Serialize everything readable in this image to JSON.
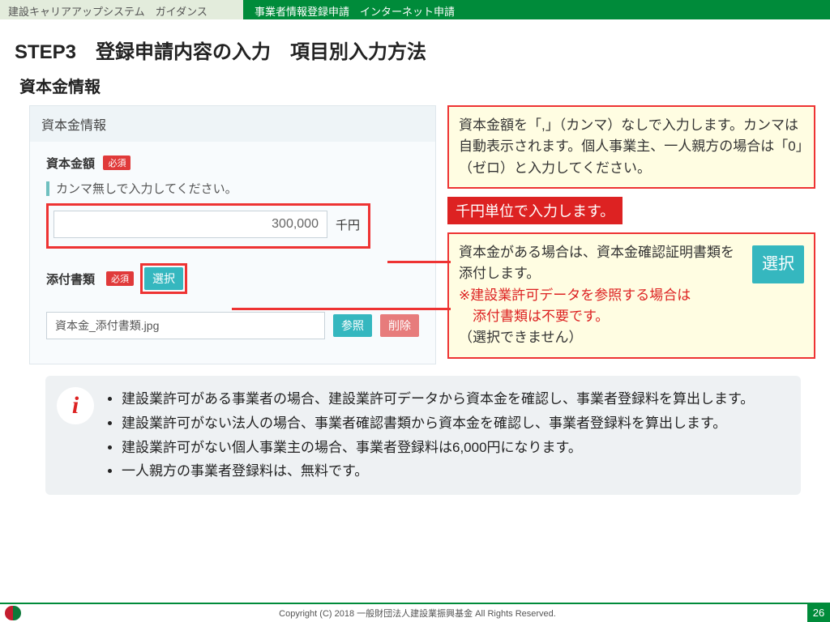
{
  "topbar": {
    "guide": "建設キャリアアップシステム　ガイダンス",
    "section": "事業者情報登録申請　インターネット申請"
  },
  "headings": {
    "step": "STEP3　登録申請内容の入力　項目別入力方法",
    "subsection": "資本金情報"
  },
  "panel": {
    "title": "資本金情報",
    "amount_label": "資本金額",
    "required_badge": "必須",
    "hint": "カンマ無しで入力してください。",
    "amount_value": "300,000",
    "unit": "千円",
    "attach_label": "添付書類",
    "select_btn": "選択",
    "file_name": "資本金_添付書類.jpg",
    "browse_btn": "参照",
    "delete_btn": "削除"
  },
  "notes": {
    "note1": "資本金額を「,」（カンマ）なしで入力します。カンマは自動表示されます。個人事業主、一人親方の場合は「0」（ゼロ）と入力してください。",
    "red_callout": "千円単位で入力します。",
    "note2_line1": "資本金がある場合は、資本金確認証明書類を添付します。",
    "note2_red1": "※建設業許可データを参照する場合は",
    "note2_red2": "　添付書類は不要です。",
    "note2_line3": "（選択できません）",
    "note2_select": "選択"
  },
  "info": {
    "icon": "i",
    "items": [
      "建設業許可がある事業者の場合、建設業許可データから資本金を確認し、事業者登録料を算出します。",
      "建設業許可がない法人の場合、事業者確認書類から資本金を確認し、事業者登録料を算出します。",
      "建設業許可がない個人事業主の場合、事業者登録料は6,000円になります。",
      "一人親方の事業者登録料は、無料です。"
    ]
  },
  "footer": {
    "copyright": "Copyright (C) 2018 一般財団法人建設業振興基金 All Rights Reserved.",
    "page": "26"
  }
}
